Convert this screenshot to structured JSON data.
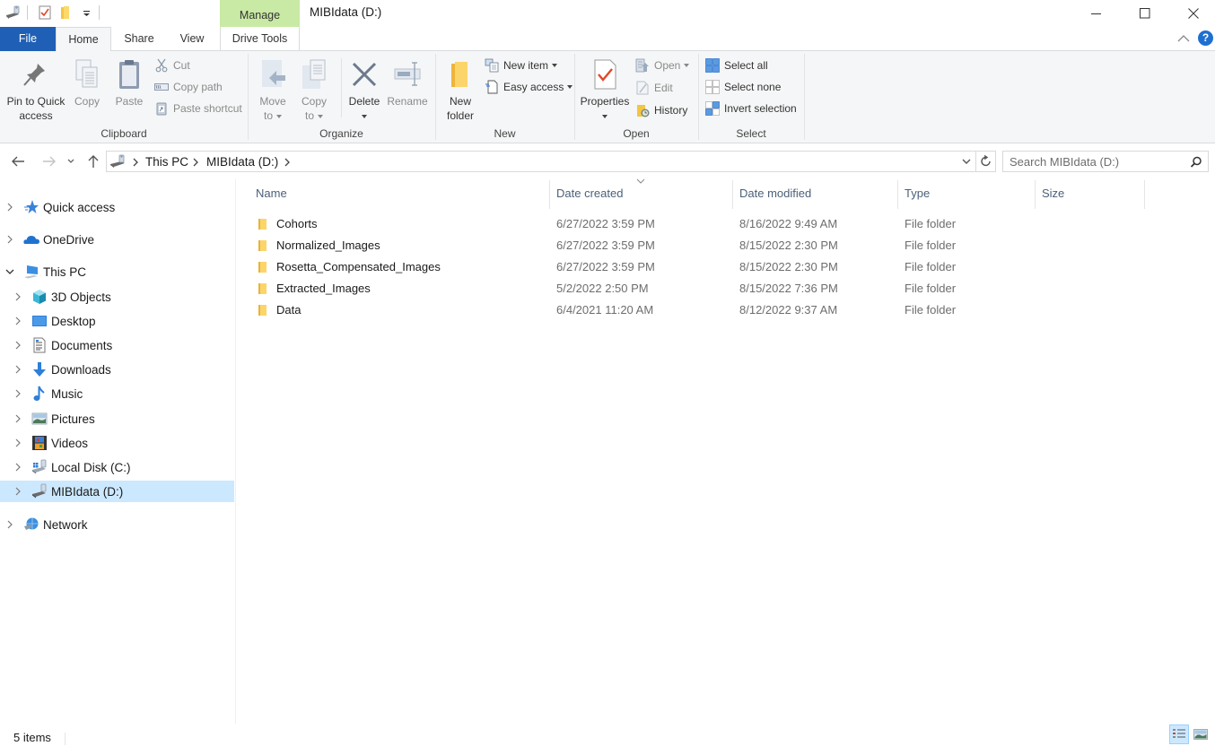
{
  "titlebar": {
    "window_title": "MIBIdata (D:)",
    "contextual_tab_group": "Manage",
    "qat": [
      "drive-icon",
      "properties-icon",
      "new-folder-icon",
      "customize-qat-icon"
    ],
    "window_buttons": [
      "minimize",
      "maximize",
      "close"
    ]
  },
  "ribbon_tabs": {
    "file": "File",
    "home": "Home",
    "share": "Share",
    "view": "View",
    "drive_tools": "Drive Tools",
    "active": "Home",
    "help": "?"
  },
  "ribbon": {
    "clipboard": {
      "label": "Clipboard",
      "pin_line1": "Pin to Quick",
      "pin_line2": "access",
      "copy": "Copy",
      "paste": "Paste",
      "cut": "Cut",
      "copy_path": "Copy path",
      "paste_shortcut": "Paste shortcut"
    },
    "organize": {
      "label": "Organize",
      "move_line1": "Move",
      "move_line2": "to",
      "copy_line1": "Copy",
      "copy_line2": "to",
      "delete": "Delete",
      "rename": "Rename"
    },
    "new": {
      "label": "New",
      "new_folder_line1": "New",
      "new_folder_line2": "folder",
      "new_item": "New item",
      "easy_access": "Easy access"
    },
    "open": {
      "label": "Open",
      "properties": "Properties",
      "open": "Open",
      "edit": "Edit",
      "history": "History"
    },
    "select": {
      "label": "Select",
      "select_all": "Select all",
      "select_none": "Select none",
      "invert_selection": "Invert selection"
    }
  },
  "address_bar": {
    "breadcrumb": [
      "This PC",
      "MIBIdata (D:)"
    ],
    "search_placeholder": "Search MIBIdata (D:)"
  },
  "nav_pane": {
    "items": [
      {
        "label": "Quick access",
        "icon": "star-icon",
        "level": 0,
        "expanded": false
      },
      {
        "label": "OneDrive",
        "icon": "cloud-icon",
        "level": 0,
        "expanded": false
      },
      {
        "label": "This PC",
        "icon": "computer-icon",
        "level": 0,
        "expanded": true
      },
      {
        "label": "3D Objects",
        "icon": "cube-icon",
        "level": 1,
        "expanded": false
      },
      {
        "label": "Desktop",
        "icon": "desktop-icon",
        "level": 1,
        "expanded": false
      },
      {
        "label": "Documents",
        "icon": "document-icon",
        "level": 1,
        "expanded": false
      },
      {
        "label": "Downloads",
        "icon": "download-icon",
        "level": 1,
        "expanded": false
      },
      {
        "label": "Music",
        "icon": "music-icon",
        "level": 1,
        "expanded": false
      },
      {
        "label": "Pictures",
        "icon": "picture-icon",
        "level": 1,
        "expanded": false
      },
      {
        "label": "Videos",
        "icon": "video-icon",
        "level": 1,
        "expanded": false
      },
      {
        "label": "Local Disk (C:)",
        "icon": "windows-drive-icon",
        "level": 1,
        "expanded": false
      },
      {
        "label": "MIBIdata (D:)",
        "icon": "drive-icon",
        "level": 1,
        "expanded": false,
        "selected": true
      },
      {
        "label": "Network",
        "icon": "network-icon",
        "level": 0,
        "expanded": false
      }
    ]
  },
  "file_list": {
    "columns": [
      "Name",
      "Date created",
      "Date modified",
      "Type",
      "Size"
    ],
    "sorted_by": "Date created",
    "rows": [
      {
        "name": "Cohorts",
        "created": "6/27/2022 3:59 PM",
        "modified": "8/16/2022 9:49 AM",
        "type": "File folder",
        "size": ""
      },
      {
        "name": "Normalized_Images",
        "created": "6/27/2022 3:59 PM",
        "modified": "8/15/2022 2:30 PM",
        "type": "File folder",
        "size": ""
      },
      {
        "name": "Rosetta_Compensated_Images",
        "created": "6/27/2022 3:59 PM",
        "modified": "8/15/2022 2:30 PM",
        "type": "File folder",
        "size": ""
      },
      {
        "name": "Extracted_Images",
        "created": "5/2/2022 2:50 PM",
        "modified": "8/15/2022 7:36 PM",
        "type": "File folder",
        "size": ""
      },
      {
        "name": "Data",
        "created": "6/4/2021 11:20 AM",
        "modified": "8/12/2022 9:37 AM",
        "type": "File folder",
        "size": ""
      }
    ]
  },
  "status_bar": {
    "item_count": "5 items",
    "active_view": "details"
  }
}
